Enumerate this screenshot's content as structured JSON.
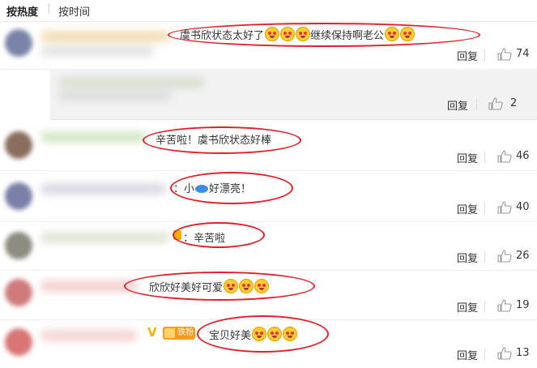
{
  "tabs": {
    "active": "按热度",
    "separator": "|",
    "other": "按时间"
  },
  "comments": [
    {
      "text": "虞书欣状态太好了",
      "emoji_count": 3,
      "text2": "继续保持啊老公",
      "emoji2_count": 2,
      "reply": "回复",
      "likes": "74"
    },
    {
      "reply": "回复",
      "likes": "2"
    },
    {
      "text": "辛苦啦！虞书欣状态好棒",
      "reply": "回复",
      "likes": "46"
    },
    {
      "prefix": "：小",
      "text": "好漂亮！",
      "reply": "回复",
      "likes": "40"
    },
    {
      "text": "：辛苦啦",
      "reply": "回复",
      "likes": "26"
    },
    {
      "text": "欣欣好美好可爱",
      "emoji_count": 3,
      "reply": "回复",
      "likes": "19"
    },
    {
      "vip": "V",
      "badge": "铁粉",
      "text": "宝贝好美",
      "emoji_count": 3,
      "reply": "回复",
      "likes": "13"
    }
  ],
  "colors": {
    "highlight_ellipse": "#e0202a",
    "like_icon": "#999999"
  },
  "icons": [
    "thumbs-up-icon",
    "emoji-icon",
    "fish-icon",
    "vip-icon",
    "fan-badge-icon"
  ]
}
